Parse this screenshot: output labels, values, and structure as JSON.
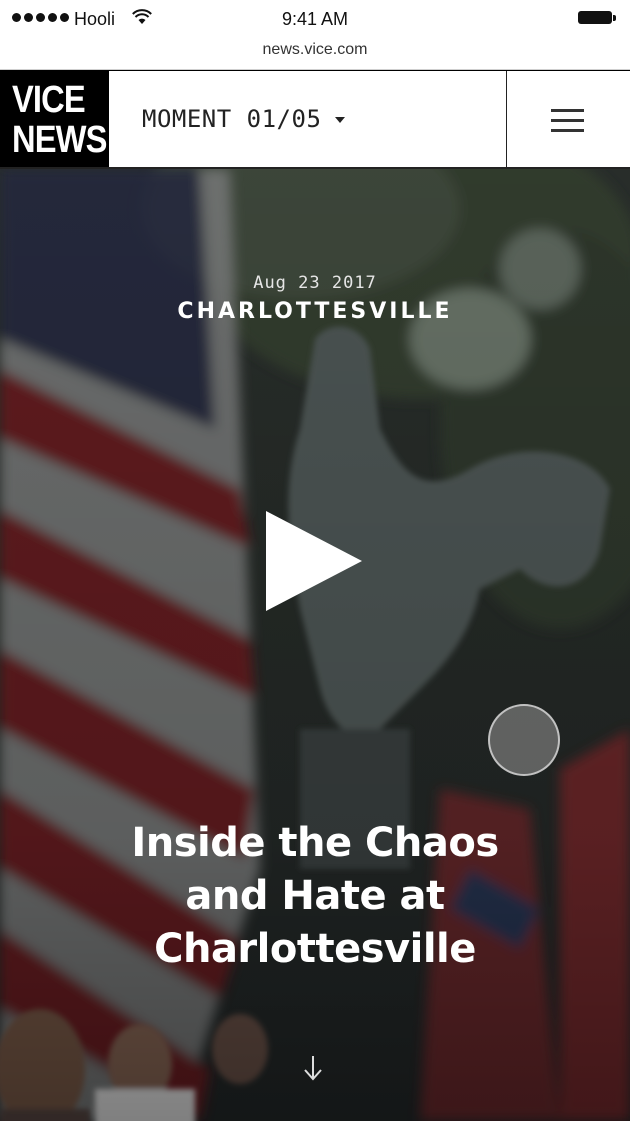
{
  "status_bar": {
    "carrier": "Hooli",
    "time": "9:41 AM",
    "url": "news.vice.com"
  },
  "header": {
    "logo_line1": "VICE",
    "logo_line2": "NEWS",
    "moment_label": "MOMENT 01/05"
  },
  "hero": {
    "date": "Aug 23 2017",
    "location": "CHARLOTTESVILLE",
    "headline_line1": "Inside the Chaos",
    "headline_line2": "and Hate at",
    "headline_line3": "Charlottesville"
  },
  "icons": {
    "menu": "hamburger-icon",
    "play": "play-icon",
    "scroll": "arrow-down-icon",
    "wifi": "wifi-icon",
    "battery": "battery-icon"
  }
}
